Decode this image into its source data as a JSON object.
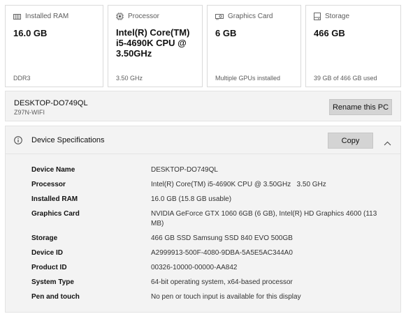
{
  "cards": [
    {
      "label": "Installed RAM",
      "value": "16.0 GB",
      "sub": "DDR3",
      "icon": "ram-icon"
    },
    {
      "label": "Processor",
      "value": "Intel(R) Core(TM) i5-4690K CPU @ 3.50GHz",
      "sub": "3.50 GHz",
      "icon": "processor-icon"
    },
    {
      "label": "Graphics Card",
      "value": "6 GB",
      "sub": "Multiple GPUs installed",
      "icon": "graphics-card-icon"
    },
    {
      "label": "Storage",
      "value": "466 GB",
      "sub": "39 GB of 466 GB used",
      "icon": "storage-icon"
    }
  ],
  "device": {
    "name": "DESKTOP-DO749QL",
    "model": "Z97N-WIFI",
    "rename_label": "Rename this PC"
  },
  "specs": {
    "title": "Device Specifications",
    "copy_label": "Copy",
    "rows": [
      {
        "key": "Device Name",
        "value": "DESKTOP-DO749QL"
      },
      {
        "key": "Processor",
        "value": "Intel(R) Core(TM) i5-4690K CPU @ 3.50GHz   3.50 GHz"
      },
      {
        "key": "Installed RAM",
        "value": "16.0 GB (15.8 GB usable)"
      },
      {
        "key": "Graphics Card",
        "value": "NVIDIA GeForce GTX 1060 6GB (6 GB), Intel(R) HD Graphics 4600 (113 MB)"
      },
      {
        "key": "Storage",
        "value": "466 GB SSD Samsung SSD 840 EVO 500GB"
      },
      {
        "key": "Device ID",
        "value": "A2999913-500F-4080-9DBA-5A5E5AC344A0"
      },
      {
        "key": "Product ID",
        "value": "00326-10000-00000-AA842"
      },
      {
        "key": "System Type",
        "value": "64-bit operating system, x64-based processor"
      },
      {
        "key": "Pen and touch",
        "value": "No pen or touch input is available for this display"
      }
    ]
  }
}
